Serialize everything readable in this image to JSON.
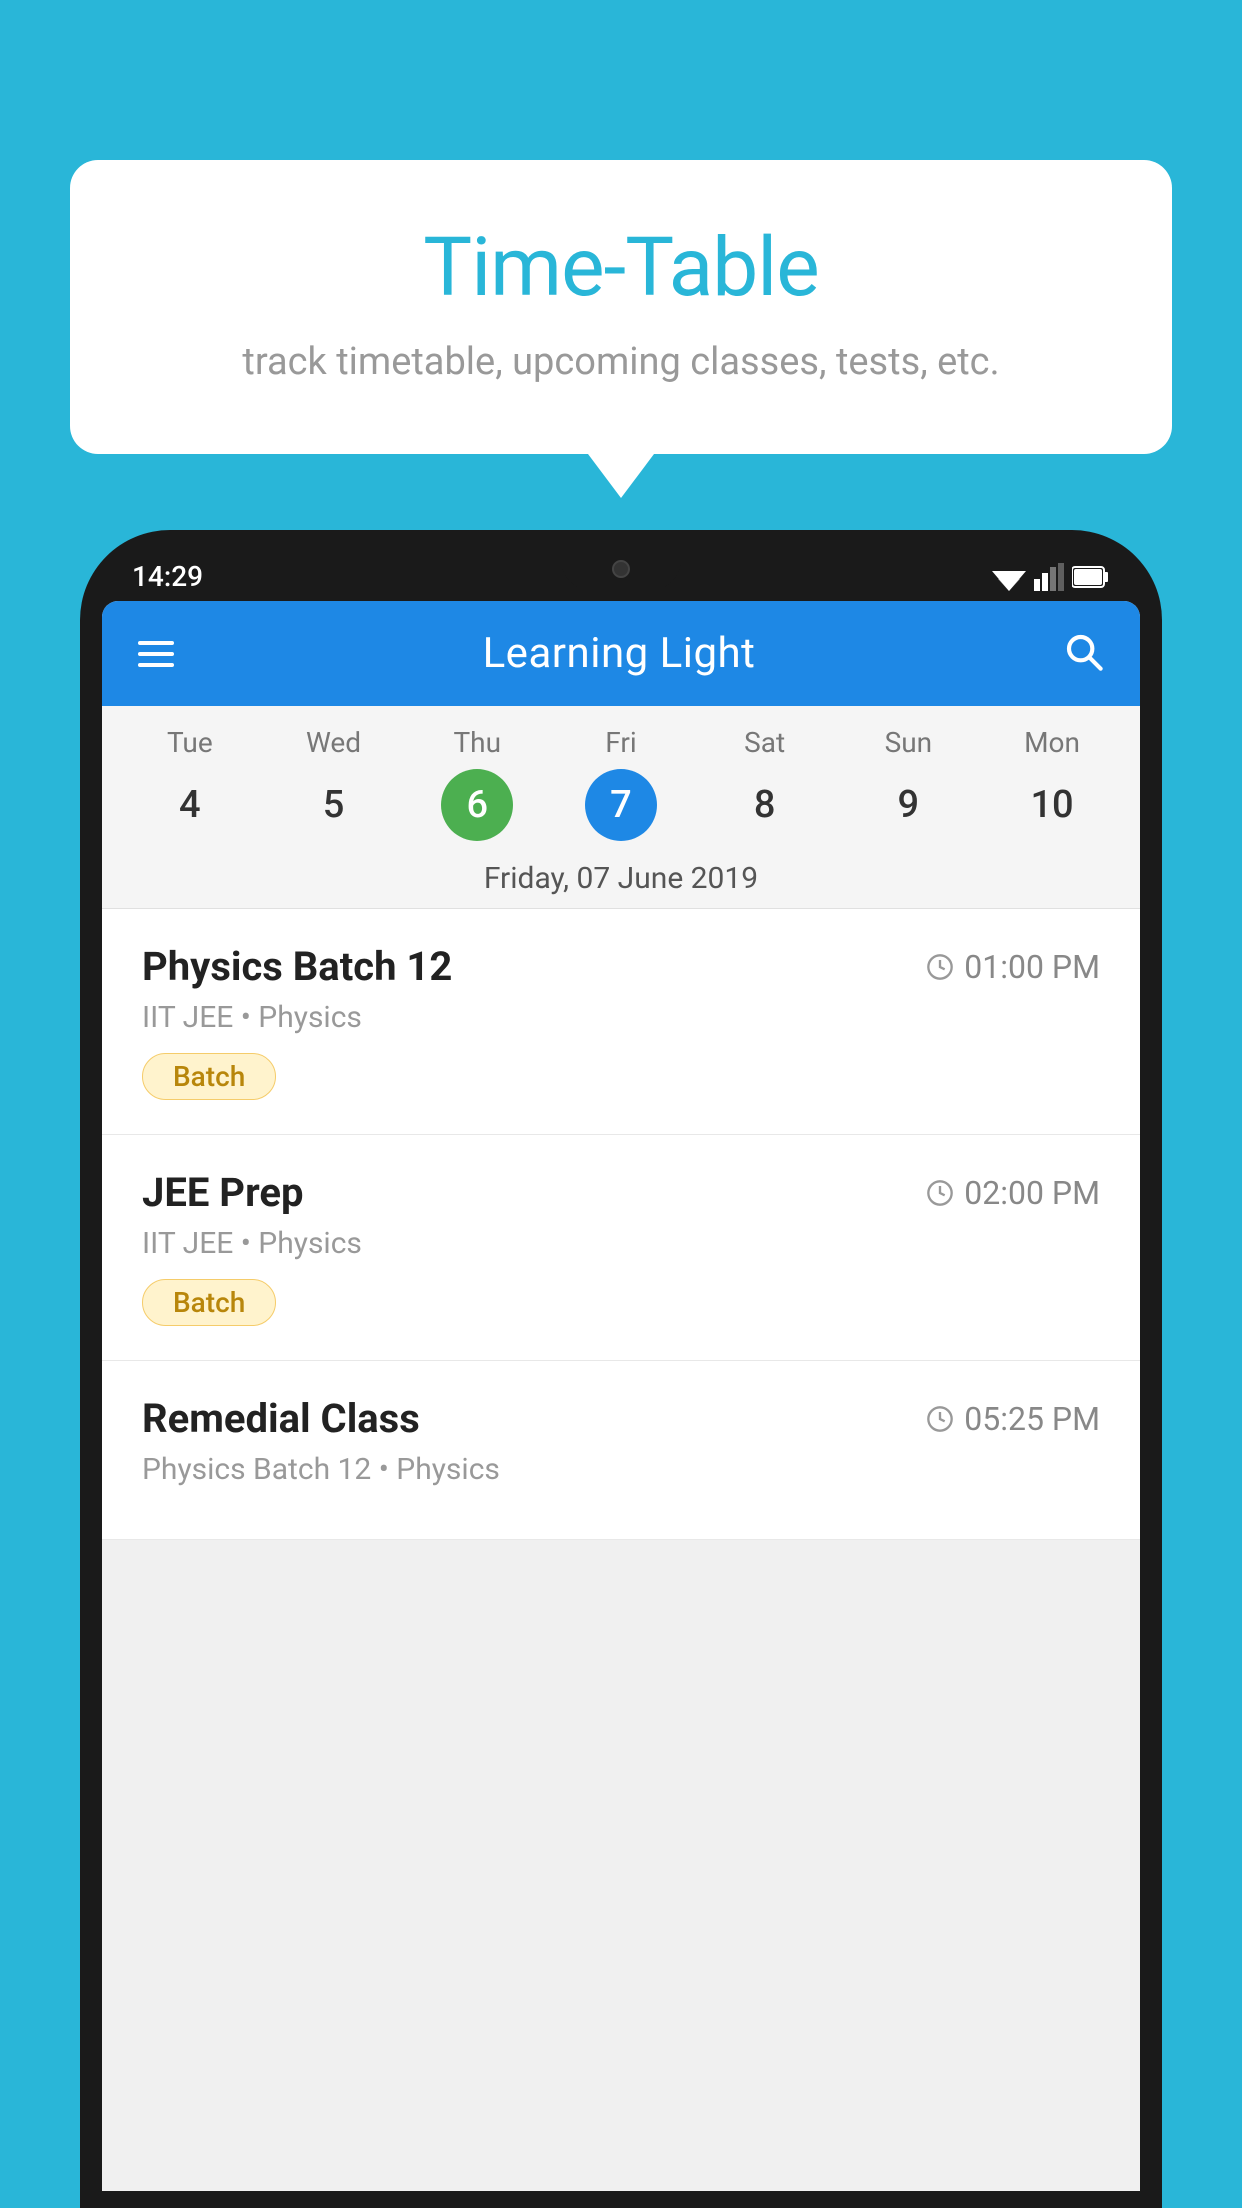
{
  "background_color": "#29B6D8",
  "speech_bubble": {
    "title": "Time-Table",
    "subtitle": "track timetable, upcoming classes, tests, etc."
  },
  "phone": {
    "status_bar": {
      "time": "14:29"
    },
    "app": {
      "toolbar": {
        "title": "Learning Light",
        "menu_label": "menu",
        "search_label": "search"
      },
      "calendar": {
        "days": [
          {
            "name": "Tue",
            "num": "4",
            "state": "normal"
          },
          {
            "name": "Wed",
            "num": "5",
            "state": "normal"
          },
          {
            "name": "Thu",
            "num": "6",
            "state": "today"
          },
          {
            "name": "Fri",
            "num": "7",
            "state": "selected"
          },
          {
            "name": "Sat",
            "num": "8",
            "state": "normal"
          },
          {
            "name": "Sun",
            "num": "9",
            "state": "normal"
          },
          {
            "name": "Mon",
            "num": "10",
            "state": "normal"
          }
        ],
        "selected_date_label": "Friday, 07 June 2019"
      },
      "schedule_items": [
        {
          "title": "Physics Batch 12",
          "time": "01:00 PM",
          "subtitle": "IIT JEE • Physics",
          "tag": "Batch"
        },
        {
          "title": "JEE Prep",
          "time": "02:00 PM",
          "subtitle": "IIT JEE • Physics",
          "tag": "Batch"
        },
        {
          "title": "Remedial Class",
          "time": "05:25 PM",
          "subtitle": "Physics Batch 12 • Physics",
          "tag": null
        }
      ]
    }
  }
}
